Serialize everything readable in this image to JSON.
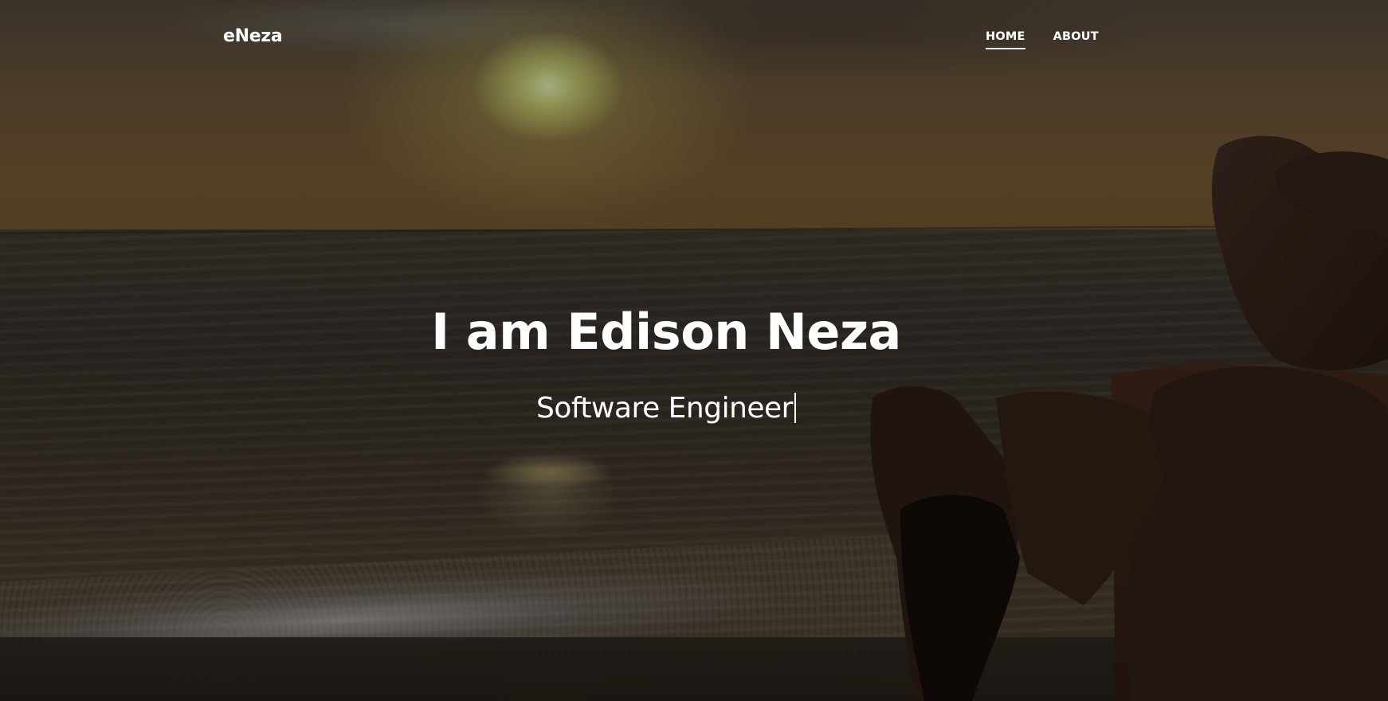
{
  "navbar": {
    "brand": "eNeza",
    "links": [
      {
        "label": "HOME",
        "active": true
      },
      {
        "label": "ABOUT",
        "active": false
      }
    ]
  },
  "hero": {
    "title": "I am Edison Neza",
    "subtitle": "Software Engineer",
    "background": "sunset-beach-photo"
  }
}
